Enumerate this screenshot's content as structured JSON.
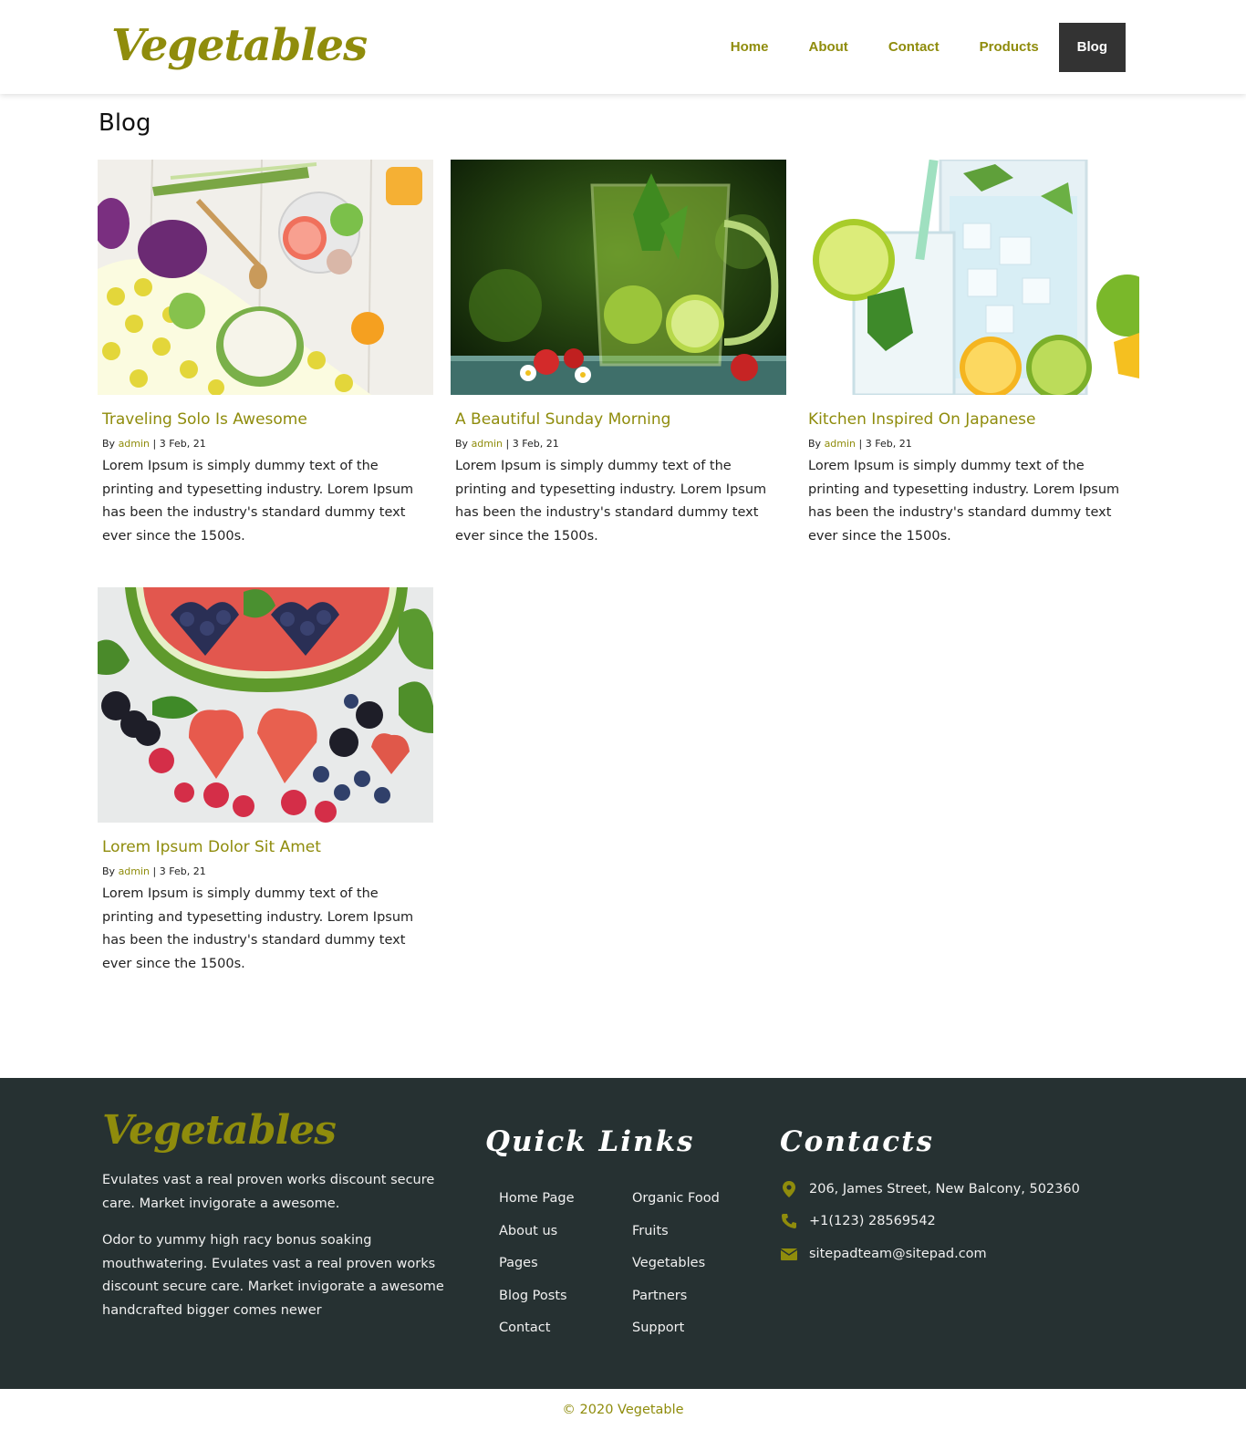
{
  "brand": {
    "logo": "Vegetables",
    "accent": "#8f8c0c",
    "footer_bg": "#263132"
  },
  "nav": [
    {
      "label": "Home"
    },
    {
      "label": "About"
    },
    {
      "label": "Contact"
    },
    {
      "label": "Products"
    },
    {
      "label": "Blog",
      "active": true
    }
  ],
  "page": {
    "title": "Blog"
  },
  "posts": [
    {
      "title": "Traveling Solo Is Awesome",
      "by": "By",
      "author": "admin",
      "sep": "|",
      "date": "3 Feb, 21",
      "excerpt": "Lorem Ipsum is simply dummy text of the printing and typesetting industry. Lorem Ipsum has been the industry's standard dummy text ever since the 1500s.",
      "image": "vegetables-table-photo"
    },
    {
      "title": "A Beautiful Sunday Morning",
      "by": "By",
      "author": "admin",
      "sep": "|",
      "date": "3 Feb, 21",
      "excerpt": "Lorem Ipsum is simply dummy text of the printing and typesetting industry. Lorem Ipsum has been the industry's standard dummy text ever since the 1500s.",
      "image": "lime-mint-drink-photo"
    },
    {
      "title": "Kitchen Inspired On Japanese",
      "by": "By",
      "author": "admin",
      "sep": "|",
      "date": "3 Feb, 21",
      "excerpt": "Lorem Ipsum is simply dummy text of the printing and typesetting industry. Lorem Ipsum has been the industry's standard dummy text ever since the 1500s.",
      "image": "lemonade-jar-photo"
    },
    {
      "title": "Lorem Ipsum Dolor Sit Amet",
      "by": "By",
      "author": "admin",
      "sep": "|",
      "date": "3 Feb, 21",
      "excerpt": "Lorem Ipsum is simply dummy text of the printing and typesetting industry. Lorem Ipsum has been the industry's standard dummy text ever since the 1500s.",
      "image": "watermelon-berries-photo"
    }
  ],
  "footer": {
    "logo": "Vegetables",
    "about": [
      "Evulates vast a real proven works discount secure care. Market invigorate a awesome.",
      "Odor to yummy high racy bonus soaking mouthwatering. Evulates vast a real proven works discount secure care. Market invigorate a awesome handcrafted bigger comes newer"
    ],
    "quick_links_title": "Quick Links",
    "links_col1": [
      "Home Page",
      "About us",
      "Pages",
      "Blog Posts",
      "Contact"
    ],
    "links_col2": [
      "Organic Food",
      "Fruits",
      "Vegetables",
      "Partners",
      "Support"
    ],
    "contacts_title": "Contacts",
    "contacts": [
      {
        "icon": "map-marker-icon",
        "text": "206, James Street, New Balcony, 502360"
      },
      {
        "icon": "phone-icon",
        "text": "+1(123) 28569542"
      },
      {
        "icon": "envelope-icon",
        "text": "sitepadteam@sitepad.com"
      }
    ],
    "copyright": "© 2020 Vegetable"
  }
}
